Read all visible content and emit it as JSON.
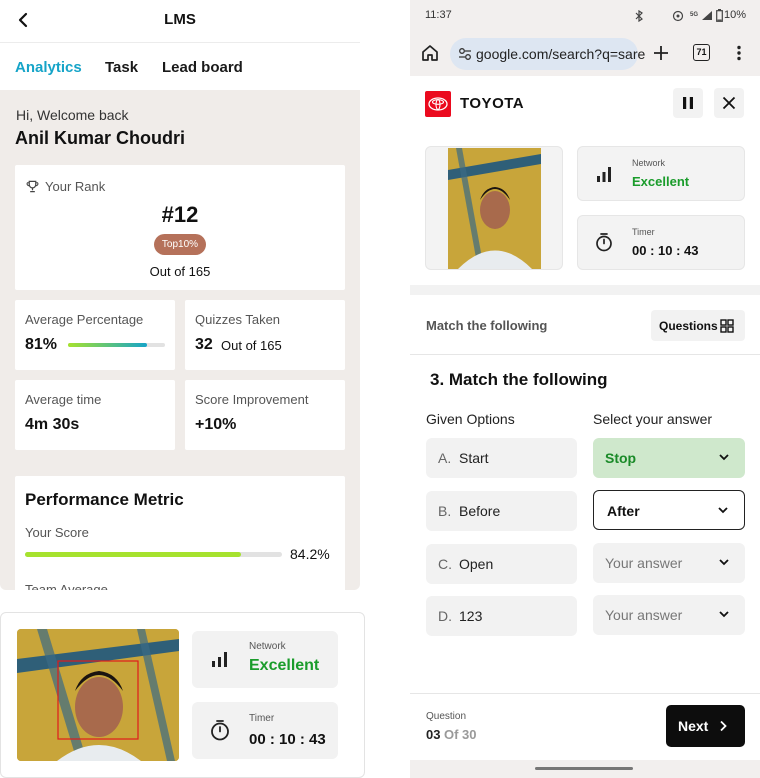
{
  "left": {
    "header": {
      "title": "LMS"
    },
    "tabs": [
      {
        "label": "Analytics",
        "active": true
      },
      {
        "label": "Task"
      },
      {
        "label": "Lead board"
      }
    ],
    "welcome": {
      "greeting": "Hi, Welcome back",
      "name": "Anil Kumar Choudri"
    },
    "rank": {
      "label": "Your Rank",
      "value": "#12",
      "badge": "Top10%",
      "out_of": "Out of 165"
    },
    "stats": [
      {
        "label": "Average Percentage",
        "value": "81%",
        "progress": 0.81
      },
      {
        "label": "Quizzes Taken",
        "value": "32",
        "suffix": "Out of 165"
      },
      {
        "label": "Average time",
        "value": "4m 30s"
      },
      {
        "label": "Score Improvement",
        "value": "+10%"
      }
    ],
    "performance": {
      "title": "Performance Metric",
      "your_score_label": "Your Score",
      "your_score_value": "84.2%",
      "your_score_progress": 0.842,
      "team_average_label": "Team Average"
    }
  },
  "proctor_left": {
    "network_label": "Network",
    "network_value": "Excellent",
    "timer_label": "Timer",
    "timer_value": "00 : 10 : 43"
  },
  "right": {
    "status": {
      "time": "11:37",
      "battery": "10%",
      "net": "5G"
    },
    "browser": {
      "url": "google.com/search?q=sare",
      "tab_count": "71"
    },
    "brand": {
      "name": "TOYOTA"
    },
    "proctor": {
      "network_label": "Network",
      "network_value": "Excellent",
      "timer_label": "Timer",
      "timer_value": "00 : 10 : 43"
    },
    "section_title": "Match the following",
    "questions_button": "Questions",
    "question_title": "3. Match the following",
    "given_options_header": "Given Options",
    "select_answer_header": "Select your answer",
    "rows": [
      {
        "letter": "A.",
        "option": "Start",
        "answer": "Stop",
        "state": "correct"
      },
      {
        "letter": "B.",
        "option": "Before",
        "answer": "After",
        "state": "selected"
      },
      {
        "letter": "C.",
        "option": "Open",
        "answer": "Your answer",
        "state": "empty"
      },
      {
        "letter": "D.",
        "option": "123",
        "answer": "Your answer",
        "state": "empty"
      }
    ],
    "footer": {
      "question_label": "Question",
      "current": "03",
      "of_total": "Of 30",
      "next_label": "Next"
    }
  },
  "colors": {
    "accent_blue": "#16a4c8",
    "green_text": "#1a9c2b",
    "correct_bg": "#cfe8cc",
    "progress_green": "#a6e22e",
    "badge_brown": "#b5715a",
    "toyota_red": "#eb0a1e"
  }
}
